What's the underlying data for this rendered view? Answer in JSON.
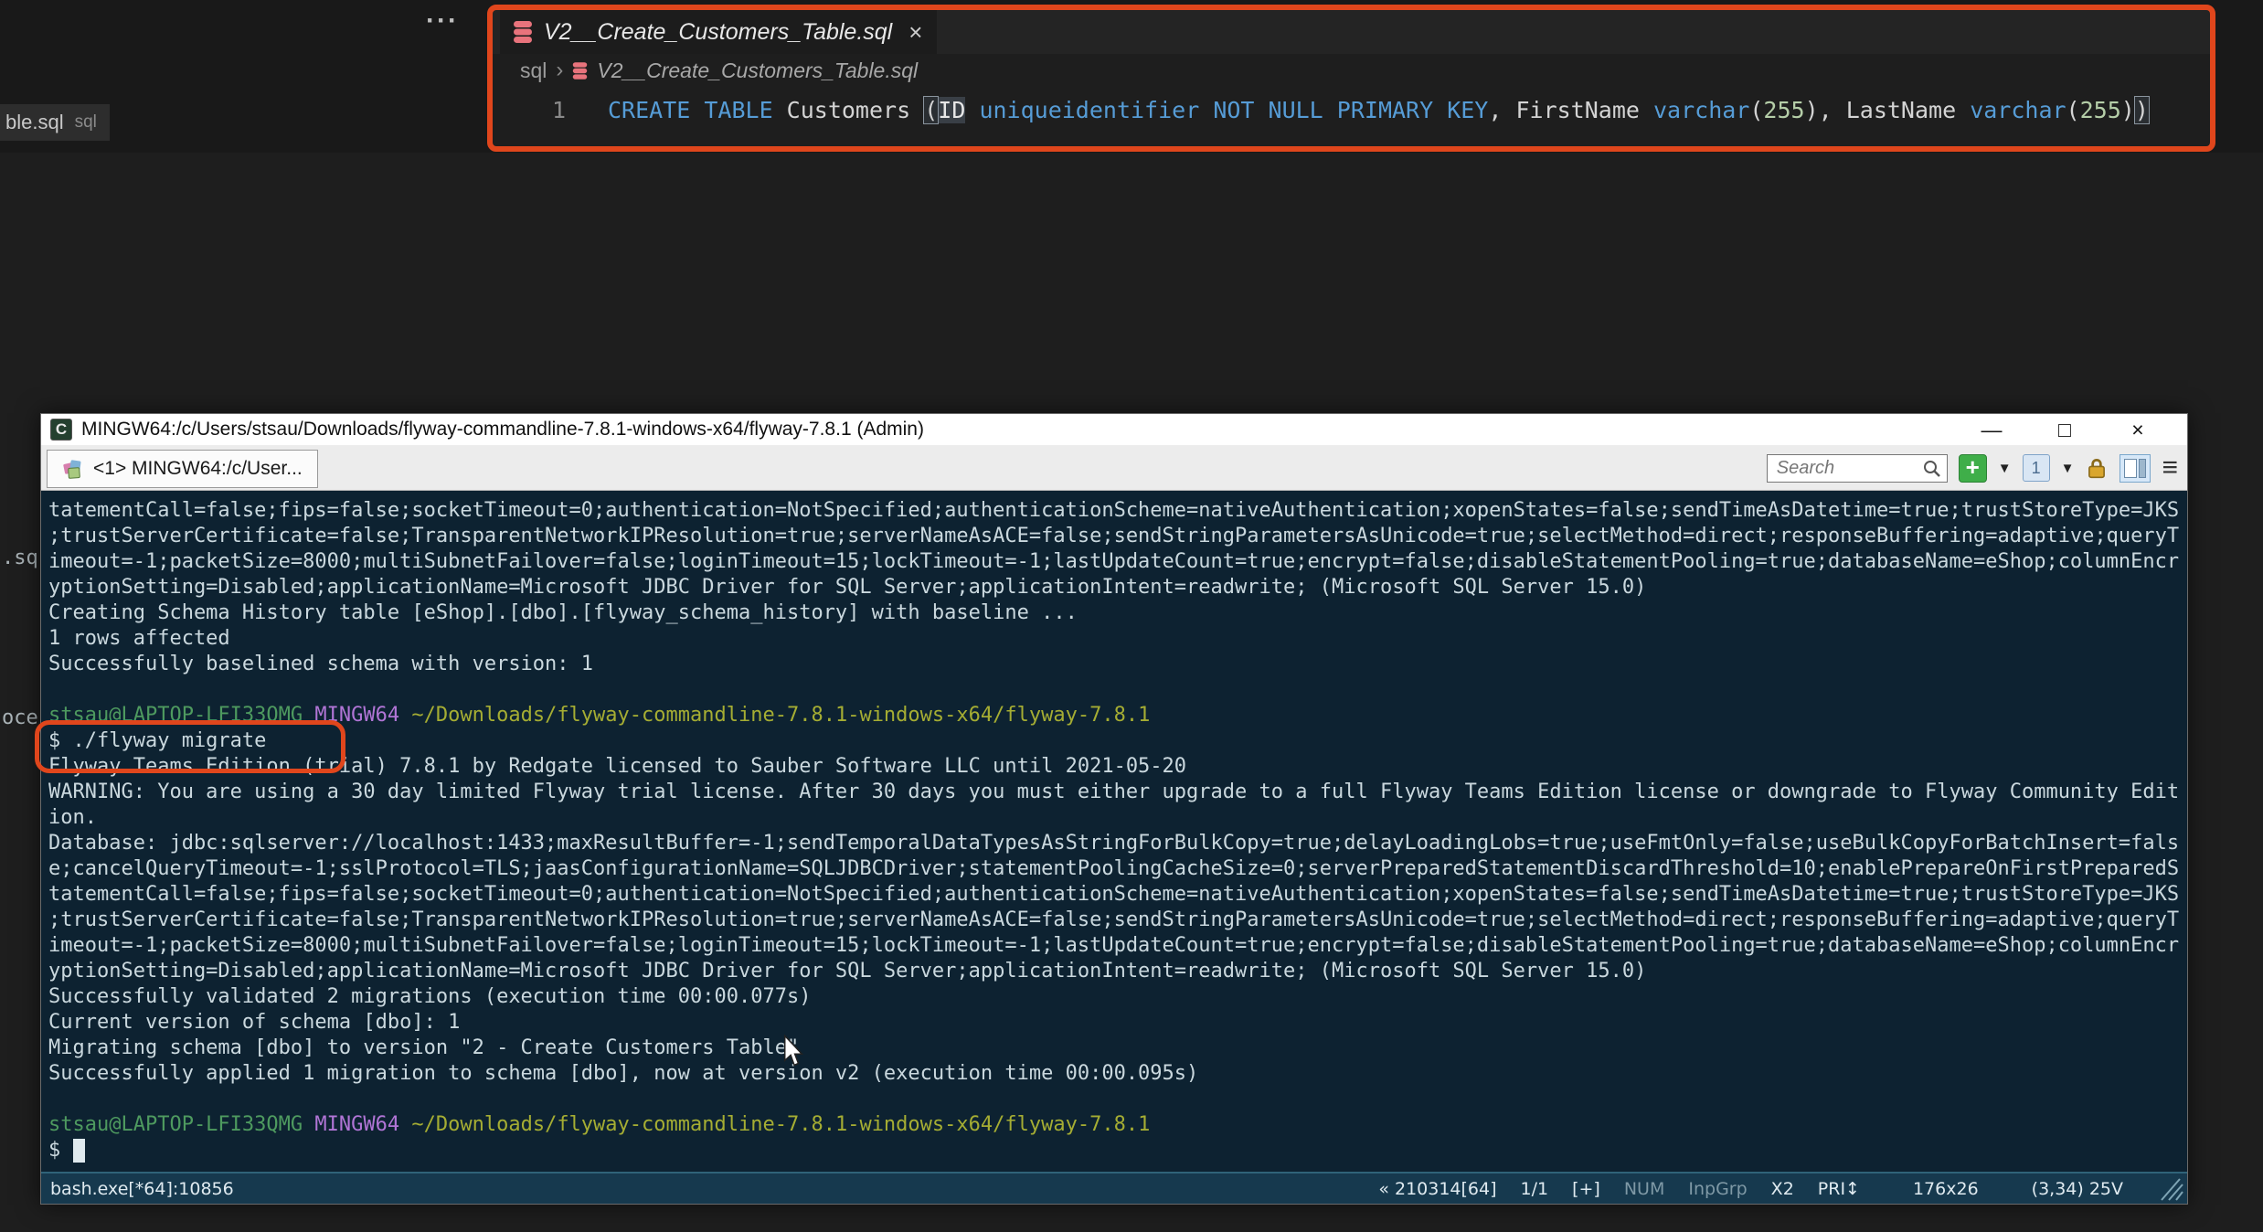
{
  "colors": {
    "annotation_red": "#e0461c",
    "keyword_blue": "#569cd6",
    "number_green": "#b5cea8",
    "db_icon_red": "#e8737c",
    "terminal_bg": "#0d2231",
    "prompt_green": "#4e9a5f",
    "prompt_purple": "#b175d6",
    "prompt_yellow": "#a5ad33",
    "plus_button_green": "#3fae49"
  },
  "fragments": {
    "top_tab_title": "ble.sql",
    "top_tab_lang": "sql",
    "ellipsis_menu": "···",
    "left_mid": ".sq",
    "left_lower": "oce"
  },
  "editor": {
    "tab": {
      "title": "V2__Create_Customers_Table.sql",
      "close": "×"
    },
    "breadcrumb": {
      "folder": "sql",
      "separator": "›",
      "file": "V2__Create_Customers_Table.sql"
    },
    "code": {
      "line_number": "1",
      "tokens": [
        {
          "t": "CREATE TABLE",
          "c": "kw"
        },
        {
          "t": " Customers ",
          "c": "plain"
        },
        {
          "t": "(",
          "c": "bracket"
        },
        {
          "t": "ID",
          "c": "hl"
        },
        {
          "t": " ",
          "c": "plain"
        },
        {
          "t": "uniqueidentifier",
          "c": "kw"
        },
        {
          "t": " ",
          "c": "plain"
        },
        {
          "t": "NOT NULL PRIMARY KEY",
          "c": "kw"
        },
        {
          "t": ", FirstName ",
          "c": "plain"
        },
        {
          "t": "varchar",
          "c": "kw"
        },
        {
          "t": "(",
          "c": "plain"
        },
        {
          "t": "255",
          "c": "num"
        },
        {
          "t": "), LastName ",
          "c": "plain"
        },
        {
          "t": "varchar",
          "c": "kw"
        },
        {
          "t": "(",
          "c": "plain"
        },
        {
          "t": "255",
          "c": "num"
        },
        {
          "t": ")",
          "c": "plain"
        },
        {
          "t": ")",
          "c": "bracket"
        }
      ]
    }
  },
  "terminal": {
    "title": "MINGW64:/c/Users/stsau/Downloads/flyway-commandline-7.8.1-windows-x64/flyway-7.8.1 (Admin)",
    "window_buttons": {
      "minimize": "—",
      "maximize": "□",
      "close": "×"
    },
    "tab_label": "<1> MINGW64:/c/User...",
    "search_placeholder": "Search",
    "icon_glyphs": {
      "conemu": "C",
      "plus": "+",
      "caret": "▼",
      "window_number": "1",
      "hamburger": "≡"
    },
    "lines": [
      [
        {
          "t": "tatementCall=false;fips=false;socketTimeout=0;authentication=NotSpecified;authenticationScheme=nativeAuthentication;xopenStates=false;sendTimeAsDatetime=true;trustStoreType=JKS"
        }
      ],
      [
        {
          "t": ";trustServerCertificate=false;TransparentNetworkIPResolution=true;serverNameAsACE=false;sendStringParametersAsUnicode=true;selectMethod=direct;responseBuffering=adaptive;queryT"
        }
      ],
      [
        {
          "t": "imeout=-1;packetSize=8000;multiSubnetFailover=false;loginTimeout=15;lockTimeout=-1;lastUpdateCount=true;encrypt=false;disableStatementPooling=true;databaseName=eShop;columnEncr"
        }
      ],
      [
        {
          "t": "yptionSetting=Disabled;applicationName=Microsoft JDBC Driver for SQL Server;applicationIntent=readwrite; (Microsoft SQL Server 15.0)"
        }
      ],
      [
        {
          "t": "Creating Schema History table [eShop].[dbo].[flyway_schema_history] with baseline ..."
        }
      ],
      [
        {
          "t": "1 rows affected"
        }
      ],
      [
        {
          "t": "Successfully baselined schema with version: 1"
        }
      ],
      [
        {
          "t": ""
        }
      ],
      [
        {
          "t": "stsau@LAPTOP-LFI33QMG ",
          "c": "green"
        },
        {
          "t": "MINGW64 ",
          "c": "purple"
        },
        {
          "t": "~/Downloads/flyway-commandline-7.8.1-windows-x64/flyway-7.8.1",
          "c": "yellow"
        }
      ],
      [
        {
          "t": "$ ./flyway migrate"
        }
      ],
      [
        {
          "t": "Flyway Teams Edition (trial) 7.8.1 by Redgate licensed to Sauber Software LLC until 2021-05-20"
        }
      ],
      [
        {
          "t": "WARNING: You are using a 30 day limited Flyway trial license. After 30 days you must either upgrade to a full Flyway Teams Edition license or downgrade to Flyway Community Edit"
        }
      ],
      [
        {
          "t": "ion."
        }
      ],
      [
        {
          "t": "Database: jdbc:sqlserver://localhost:1433;maxResultBuffer=-1;sendTemporalDataTypesAsStringForBulkCopy=true;delayLoadingLobs=true;useFmtOnly=false;useBulkCopyForBatchInsert=fals"
        }
      ],
      [
        {
          "t": "e;cancelQueryTimeout=-1;sslProtocol=TLS;jaasConfigurationName=SQLJDBCDriver;statementPoolingCacheSize=0;serverPreparedStatementDiscardThreshold=10;enablePrepareOnFirstPreparedS"
        }
      ],
      [
        {
          "t": "tatementCall=false;fips=false;socketTimeout=0;authentication=NotSpecified;authenticationScheme=nativeAuthentication;xopenStates=false;sendTimeAsDatetime=true;trustStoreType=JKS"
        }
      ],
      [
        {
          "t": ";trustServerCertificate=false;TransparentNetworkIPResolution=true;serverNameAsACE=false;sendStringParametersAsUnicode=true;selectMethod=direct;responseBuffering=adaptive;queryT"
        }
      ],
      [
        {
          "t": "imeout=-1;packetSize=8000;multiSubnetFailover=false;loginTimeout=15;lockTimeout=-1;lastUpdateCount=true;encrypt=false;disableStatementPooling=true;databaseName=eShop;columnEncr"
        }
      ],
      [
        {
          "t": "yptionSetting=Disabled;applicationName=Microsoft JDBC Driver for SQL Server;applicationIntent=readwrite; (Microsoft SQL Server 15.0)"
        }
      ],
      [
        {
          "t": "Successfully validated 2 migrations (execution time 00:00.077s)"
        }
      ],
      [
        {
          "t": "Current version of schema [dbo]: 1"
        }
      ],
      [
        {
          "t": "Migrating schema [dbo] to version \"2 - Create Customers Table\""
        }
      ],
      [
        {
          "t": "Successfully applied 1 migration to schema [dbo], now at version v2 (execution time 00:00.095s)"
        }
      ],
      [
        {
          "t": ""
        }
      ],
      [
        {
          "t": "stsau@LAPTOP-LFI33QMG ",
          "c": "green"
        },
        {
          "t": "MINGW64 ",
          "c": "purple"
        },
        {
          "t": "~/Downloads/flyway-commandline-7.8.1-windows-x64/flyway-7.8.1",
          "c": "yellow"
        }
      ],
      [
        {
          "t": "$ "
        },
        {
          "t": " ",
          "c": "cursor"
        }
      ]
    ],
    "statusbar": {
      "left": "bash.exe[*64]:10856",
      "fields": [
        {
          "t": "« 210314[64]"
        },
        {
          "t": "1/1"
        },
        {
          "t": "[+]"
        },
        {
          "t": "NUM",
          "dim": true
        },
        {
          "t": "InpGrp",
          "dim": true
        },
        {
          "t": "X2"
        },
        {
          "t": "PRI↕"
        },
        {
          "t": "176x26",
          "wide": true
        },
        {
          "t": "(3,34) 25V",
          "wide": true
        }
      ]
    }
  }
}
